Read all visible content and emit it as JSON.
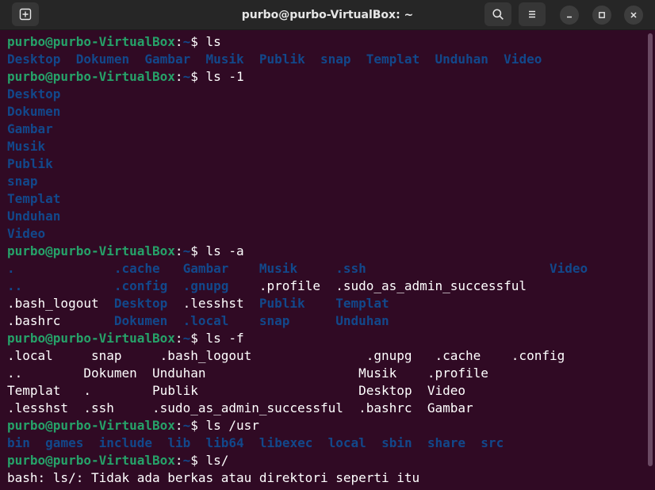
{
  "window": {
    "title": "purbo@purbo-VirtualBox: ~"
  },
  "icons": [
    "new-tab-icon",
    "search-icon",
    "menu-icon",
    "minimize-icon",
    "maximize-icon",
    "close-icon"
  ],
  "colors": {
    "background": "#300a24",
    "prompt_user": "#26a269",
    "directory": "#12488b",
    "text": "#ffffff"
  },
  "prompt": {
    "user_host": "purbo@purbo-VirtualBox",
    "colon": ":",
    "path": "~",
    "symbol": "$ "
  },
  "terminal": {
    "cmd1": "ls",
    "out1": [
      "Desktop",
      "Dokumen",
      "Gambar",
      "Musik",
      "Publik",
      "snap",
      "Templat",
      "Unduhan",
      "Video"
    ],
    "cmd2": "ls -1",
    "out2": [
      "Desktop",
      "Dokumen",
      "Gambar",
      "Musik",
      "Publik",
      "snap",
      "Templat",
      "Unduhan",
      "Video"
    ],
    "cmd3": "ls -a",
    "out3": [
      [
        ".",
        ".cache",
        "Gambar",
        "Musik",
        ".ssh",
        "Video"
      ],
      [
        "..",
        ".config",
        ".gnupg",
        ".profile",
        ".sudo_as_admin_successful"
      ],
      [
        ".bash_logout",
        "Desktop",
        ".lesshst",
        "Publik",
        "Templat"
      ],
      [
        ".bashrc",
        "Dokumen",
        ".local",
        "snap",
        "Unduhan"
      ]
    ],
    "cmd4": "ls -f",
    "out4": [
      [
        ".local",
        "snap",
        ".bash_logout",
        ".gnupg",
        ".cache",
        ".config"
      ],
      [
        "..",
        "Dokumen",
        "Unduhan",
        "Musik",
        ".profile"
      ],
      [
        "Templat",
        ".",
        "Publik",
        "Desktop",
        "Video"
      ],
      [
        ".lesshst",
        ".ssh",
        ".sudo_as_admin_successful",
        ".bashrc",
        "Gambar"
      ]
    ],
    "cmd5": "ls /usr",
    "out5": [
      "bin",
      "games",
      "include",
      "lib",
      "lib64",
      "libexec",
      "local",
      "sbin",
      "share",
      "src"
    ],
    "cmd6": "ls/",
    "error": "bash: ls/: Tidak ada berkas atau direktori seperti itu"
  }
}
